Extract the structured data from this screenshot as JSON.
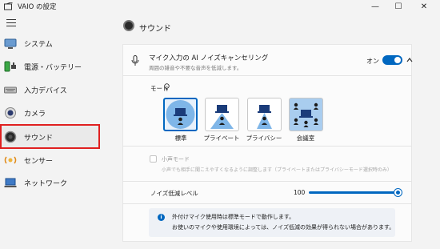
{
  "window": {
    "title": "VAIO の設定",
    "minimize": "—",
    "maximize": "☐",
    "close": "✕"
  },
  "sidebar": {
    "items": [
      {
        "label": "システム",
        "icon": "system-icon"
      },
      {
        "label": "電源・バッテリー",
        "icon": "battery-icon"
      },
      {
        "label": "入力デバイス",
        "icon": "keyboard-icon"
      },
      {
        "label": "カメラ",
        "icon": "camera-icon"
      },
      {
        "label": "サウンド",
        "icon": "speaker-icon",
        "selected": true
      },
      {
        "label": "センサー",
        "icon": "sensor-icon"
      },
      {
        "label": "ネットワーク",
        "icon": "network-icon"
      }
    ]
  },
  "page": {
    "title": "サウンド"
  },
  "noise_cancel": {
    "title": "マイク入力の AI ノイズキャンセリング",
    "subtitle": "周囲の雑音や不要な音声を低減します。",
    "toggle_label": "オン",
    "enabled": true
  },
  "mode": {
    "label": "モード",
    "options": [
      {
        "label": "標準",
        "selected": true
      },
      {
        "label": "プライベート",
        "selected": false
      },
      {
        "label": "プライバシー",
        "selected": false
      },
      {
        "label": "会議室",
        "selected": false
      }
    ]
  },
  "small_voice": {
    "label": "小声モード",
    "description": "小声でも相手に聞こえやすくなるように調整します（プライベートまたはプライバシーモード選択時のみ）",
    "checked": false,
    "disabled": true
  },
  "noise_level": {
    "label": "ノイズ低減レベル",
    "value": "100",
    "fraction": 1.0
  },
  "info": {
    "line1": "外付けマイク使用時は標準モードで動作します。",
    "line2": "お使いのマイクや使用環境によっては、ノイズ低減の効果が得られない場合があります。"
  },
  "colors": {
    "accent": "#0067c0",
    "selection_outline": "#e02020"
  }
}
